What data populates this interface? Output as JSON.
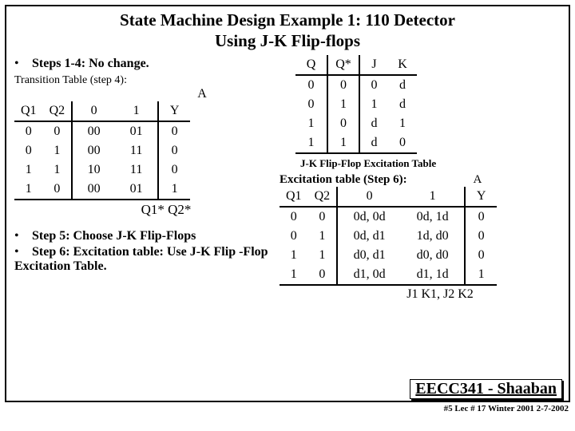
{
  "title_line1": "State Machine Design Example 1:  110 Detector",
  "title_line2": "Using J-K Flip-flops",
  "bullets": {
    "b1": "Steps 1-4:  No change.",
    "b5": "Step 5:  Choose J-K Flip-Flops",
    "b6": "Step 6:  Excitation table: Use J-K Flip -Flop Excitation Table."
  },
  "trans_label": "Transition Table (step 4):",
  "A_label": "A",
  "trans_headers": {
    "q1": "Q1",
    "q2": "Q2",
    "c0": "0",
    "c1": "1",
    "y": "Y"
  },
  "transition": [
    {
      "q1": "0",
      "q2": "0",
      "a0": "00",
      "a1": "01",
      "y": "0"
    },
    {
      "q1": "0",
      "q2": "1",
      "a0": "00",
      "a1": "11",
      "y": "0"
    },
    {
      "q1": "1",
      "q2": "1",
      "a0": "10",
      "a1": "11",
      "y": "0"
    },
    {
      "q1": "1",
      "q2": "0",
      "a0": "00",
      "a1": "01",
      "y": "1"
    }
  ],
  "q1q2star": "Q1* Q2*",
  "jkex_caption": "J-K Flip-Flop Excitation Table",
  "jkex_headers": {
    "Q": "Q",
    "Qs": "Q*",
    "J": "J",
    "K": "K"
  },
  "jkex": [
    {
      "Q": "0",
      "Qs": "0",
      "J": "0",
      "K": "d"
    },
    {
      "Q": "0",
      "Qs": "1",
      "J": "1",
      "K": "d"
    },
    {
      "Q": "1",
      "Qs": "0",
      "J": "d",
      "K": "1"
    },
    {
      "Q": "1",
      "Qs": "1",
      "J": "d",
      "K": "0"
    }
  ],
  "ex_label": "Excitation table (Step 6):",
  "ex_headers": {
    "q1": "Q1",
    "q2": "Q2",
    "c0": "0",
    "c1": "1",
    "y": "Y"
  },
  "excitation": [
    {
      "q1": "0",
      "q2": "0",
      "a0": "0d, 0d",
      "a1": "0d, 1d",
      "y": "0"
    },
    {
      "q1": "0",
      "q2": "1",
      "a0": "0d, d1",
      "a1": "1d, d0",
      "y": "0"
    },
    {
      "q1": "1",
      "q2": "1",
      "a0": "d0, d1",
      "a1": "d0, d0",
      "y": "0"
    },
    {
      "q1": "1",
      "q2": "0",
      "a0": "d1, 0d",
      "a1": "d1, 1d",
      "y": "1"
    }
  ],
  "jkfoot": "J1 K1, J2 K2",
  "course": "EECC341 - Shaaban",
  "meta": "#5  Lec # 17   Winter 2001   2-7-2002",
  "chart_data": [
    {
      "type": "table",
      "title": "Transition Table (step 4)",
      "columns": [
        "Q1",
        "Q2",
        "A=0",
        "A=1",
        "Y"
      ],
      "rows": [
        [
          "0",
          "0",
          "00",
          "01",
          "0"
        ],
        [
          "0",
          "1",
          "00",
          "11",
          "0"
        ],
        [
          "1",
          "1",
          "10",
          "11",
          "0"
        ],
        [
          "1",
          "0",
          "00",
          "01",
          "1"
        ]
      ],
      "note": "Cells under A=0/A=1 are next state Q1*Q2*"
    },
    {
      "type": "table",
      "title": "J-K Flip-Flop Excitation Table",
      "columns": [
        "Q",
        "Q*",
        "J",
        "K"
      ],
      "rows": [
        [
          "0",
          "0",
          "0",
          "d"
        ],
        [
          "0",
          "1",
          "1",
          "d"
        ],
        [
          "1",
          "0",
          "d",
          "1"
        ],
        [
          "1",
          "1",
          "d",
          "0"
        ]
      ]
    },
    {
      "type": "table",
      "title": "Excitation table (Step 6)",
      "columns": [
        "Q1",
        "Q2",
        "A=0",
        "A=1",
        "Y"
      ],
      "rows": [
        [
          "0",
          "0",
          "0d, 0d",
          "0d, 1d",
          "0"
        ],
        [
          "0",
          "1",
          "0d, d1",
          "1d, d0",
          "0"
        ],
        [
          "1",
          "1",
          "d0, d1",
          "d0, d0",
          "0"
        ],
        [
          "1",
          "0",
          "d1, 0d",
          "d1, 1d",
          "1"
        ]
      ],
      "note": "Cells are J1 K1, J2 K2"
    }
  ]
}
